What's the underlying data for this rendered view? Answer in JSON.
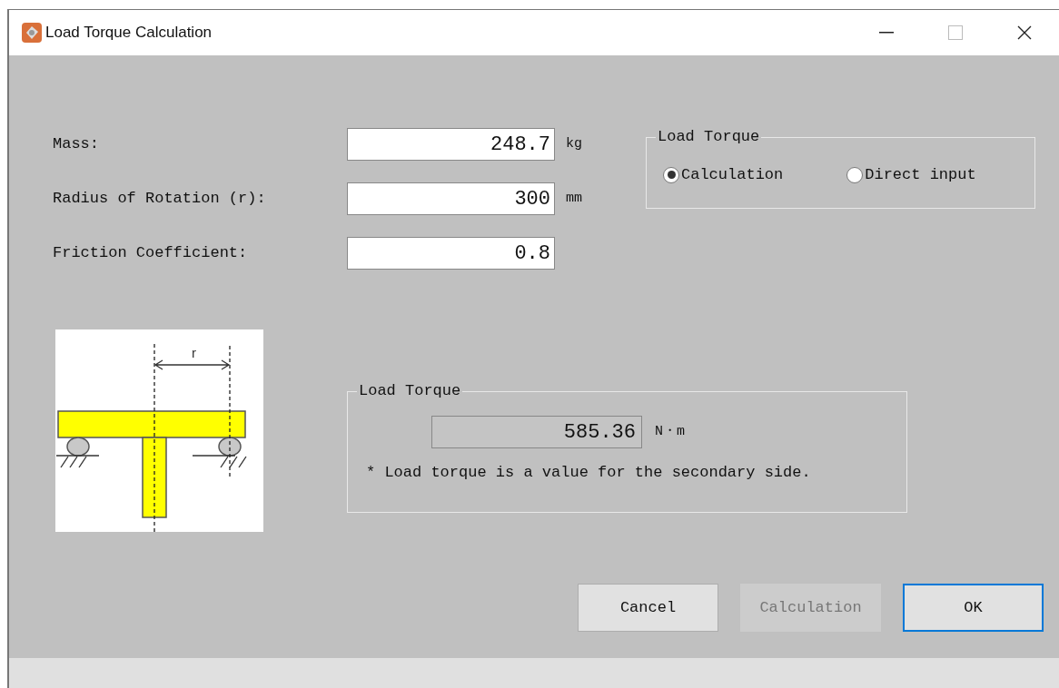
{
  "window": {
    "title": "Load Torque Calculation"
  },
  "fields": [
    {
      "label": "Mass:",
      "value": "248.7",
      "unit": "kg"
    },
    {
      "label": "Radius of Rotation (r):",
      "value": "300",
      "unit": "mm"
    },
    {
      "label": "Friction Coefficient:",
      "value": "0.8"
    }
  ],
  "mode_group": {
    "title": "Load Torque",
    "options": [
      {
        "label": "Calculation",
        "selected": true
      },
      {
        "label": "Direct input",
        "selected": false
      }
    ]
  },
  "diagram": {
    "label": "r"
  },
  "result_group": {
    "title": "Load Torque",
    "value": "585.36",
    "unit": "N・m",
    "note": "* Load torque is a value for the secondary side."
  },
  "buttons": [
    {
      "label": "Cancel",
      "disabled": false,
      "default": false
    },
    {
      "label": "Calculation",
      "disabled": true,
      "default": false
    },
    {
      "label": "OK",
      "disabled": false,
      "default": true
    }
  ]
}
